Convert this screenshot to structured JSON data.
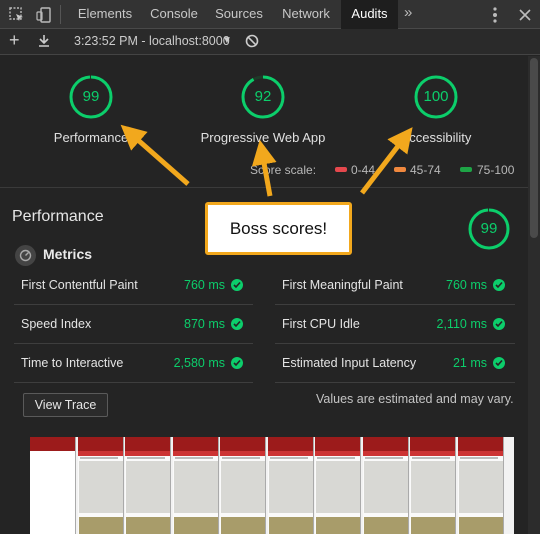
{
  "tabs": [
    {
      "label": "Elements"
    },
    {
      "label": "Console"
    },
    {
      "label": "Sources"
    },
    {
      "label": "Network"
    },
    {
      "label": "Audits",
      "active": true
    }
  ],
  "toolbar": {
    "report": "3:23:52 PM - localhost:8000"
  },
  "scores": [
    {
      "value": "99",
      "label": "Performance",
      "fraction": 0.99
    },
    {
      "value": "92",
      "label": "Progressive Web App",
      "fraction": 0.92
    },
    {
      "value": "100",
      "label": "Accessibility",
      "fraction": 1.0
    }
  ],
  "score_scale": {
    "label": "Score scale:",
    "ranges": [
      {
        "text": "0-44",
        "color": "#e5484d"
      },
      {
        "text": "45-74",
        "color": "#f0883e"
      },
      {
        "text": "75-100",
        "color": "#1ea446"
      }
    ]
  },
  "performance": {
    "title": "Performance",
    "score": "99",
    "score_fraction": 0.99,
    "metrics_title": "Metrics",
    "metrics_left": [
      {
        "label": "First Contentful Paint",
        "value": "760 ms"
      },
      {
        "label": "Speed Index",
        "value": "870 ms"
      },
      {
        "label": "Time to Interactive",
        "value": "2,580 ms"
      }
    ],
    "metrics_right": [
      {
        "label": "First Meaningful Paint",
        "value": "760 ms"
      },
      {
        "label": "First CPU Idle",
        "value": "2,110 ms"
      },
      {
        "label": "Estimated Input Latency",
        "value": "21 ms"
      }
    ],
    "view_trace": "View Trace",
    "estimate_note": "Values are estimated and may vary."
  },
  "callout": {
    "text": "Boss scores!"
  },
  "colors": {
    "pass": "#0cce6b",
    "arrow": "#f2a81d"
  },
  "icons": [
    "inspect-icon",
    "device-toggle-icon",
    "more-tabs-icon",
    "settings-icon",
    "close-icon",
    "add-icon",
    "download-icon",
    "dropdown-icon",
    "clear-icon",
    "metrics-icon",
    "check-icon"
  ]
}
